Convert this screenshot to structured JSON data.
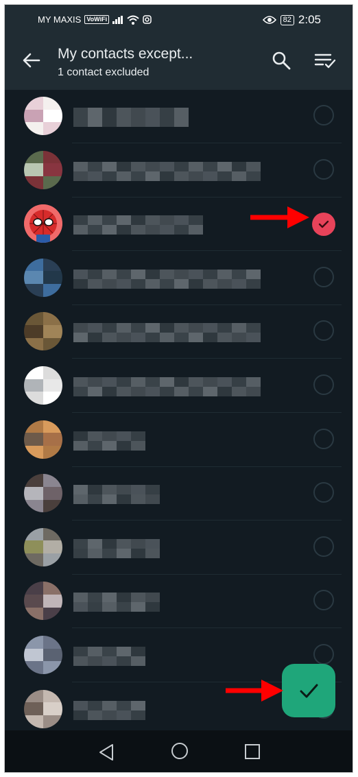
{
  "status_bar": {
    "carrier": "MY MAXIS",
    "vowifi": "VoWiFi",
    "battery": "82",
    "time": "2:05"
  },
  "app_bar": {
    "title": "My contacts except...",
    "subtitle": "1 contact excluded",
    "icons": [
      "back-arrow-icon",
      "search-icon",
      "select-all-icon"
    ]
  },
  "contacts": [
    {
      "name_visible": false,
      "selected": false
    },
    {
      "name_visible": false,
      "selected": false
    },
    {
      "name_visible": false,
      "selected": true
    },
    {
      "name_visible": false,
      "selected": false
    },
    {
      "name_visible": false,
      "selected": false
    },
    {
      "name_visible": false,
      "selected": false
    },
    {
      "name_visible": false,
      "selected": false
    },
    {
      "name_visible": false,
      "selected": false
    },
    {
      "name_visible": false,
      "selected": false
    },
    {
      "name_visible": false,
      "selected": false
    },
    {
      "name_visible": false,
      "selected": false
    },
    {
      "name_visible": false,
      "selected": false
    }
  ],
  "colors": {
    "background": "#121b22",
    "app_bar": "#202c33",
    "selected_check": "#e8435a",
    "fab": "#1fa67a",
    "annotation_arrow": "#ff0000"
  },
  "fab_icon": "checkmark-icon",
  "nav_icons": [
    "nav-back-icon",
    "nav-home-icon",
    "nav-recents-icon"
  ]
}
